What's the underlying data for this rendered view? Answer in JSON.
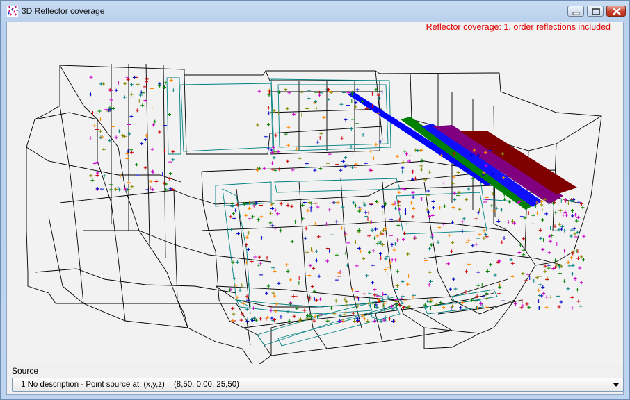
{
  "window": {
    "title": "3D Reflector coverage",
    "controls": [
      "minimize",
      "maximize",
      "close"
    ]
  },
  "viewport": {
    "coverage_label": "Reflector coverage: 1. order reflections included",
    "colors": {
      "wireframe": "#000000",
      "reflector_edges": "#008080",
      "reflector_bands": [
        "#0000ff",
        "#008000",
        "#1010ff",
        "#800080",
        "#800000"
      ],
      "hit_markers": [
        "#0000cc",
        "#cc0000",
        "#008000",
        "#cc00cc",
        "#888800",
        "#008080",
        "#ff8800"
      ]
    }
  },
  "source": {
    "label": "Source",
    "selected": "1 No description  -  Point source at: (x,y,z) = (8,50, 0,00, 25,50)"
  }
}
